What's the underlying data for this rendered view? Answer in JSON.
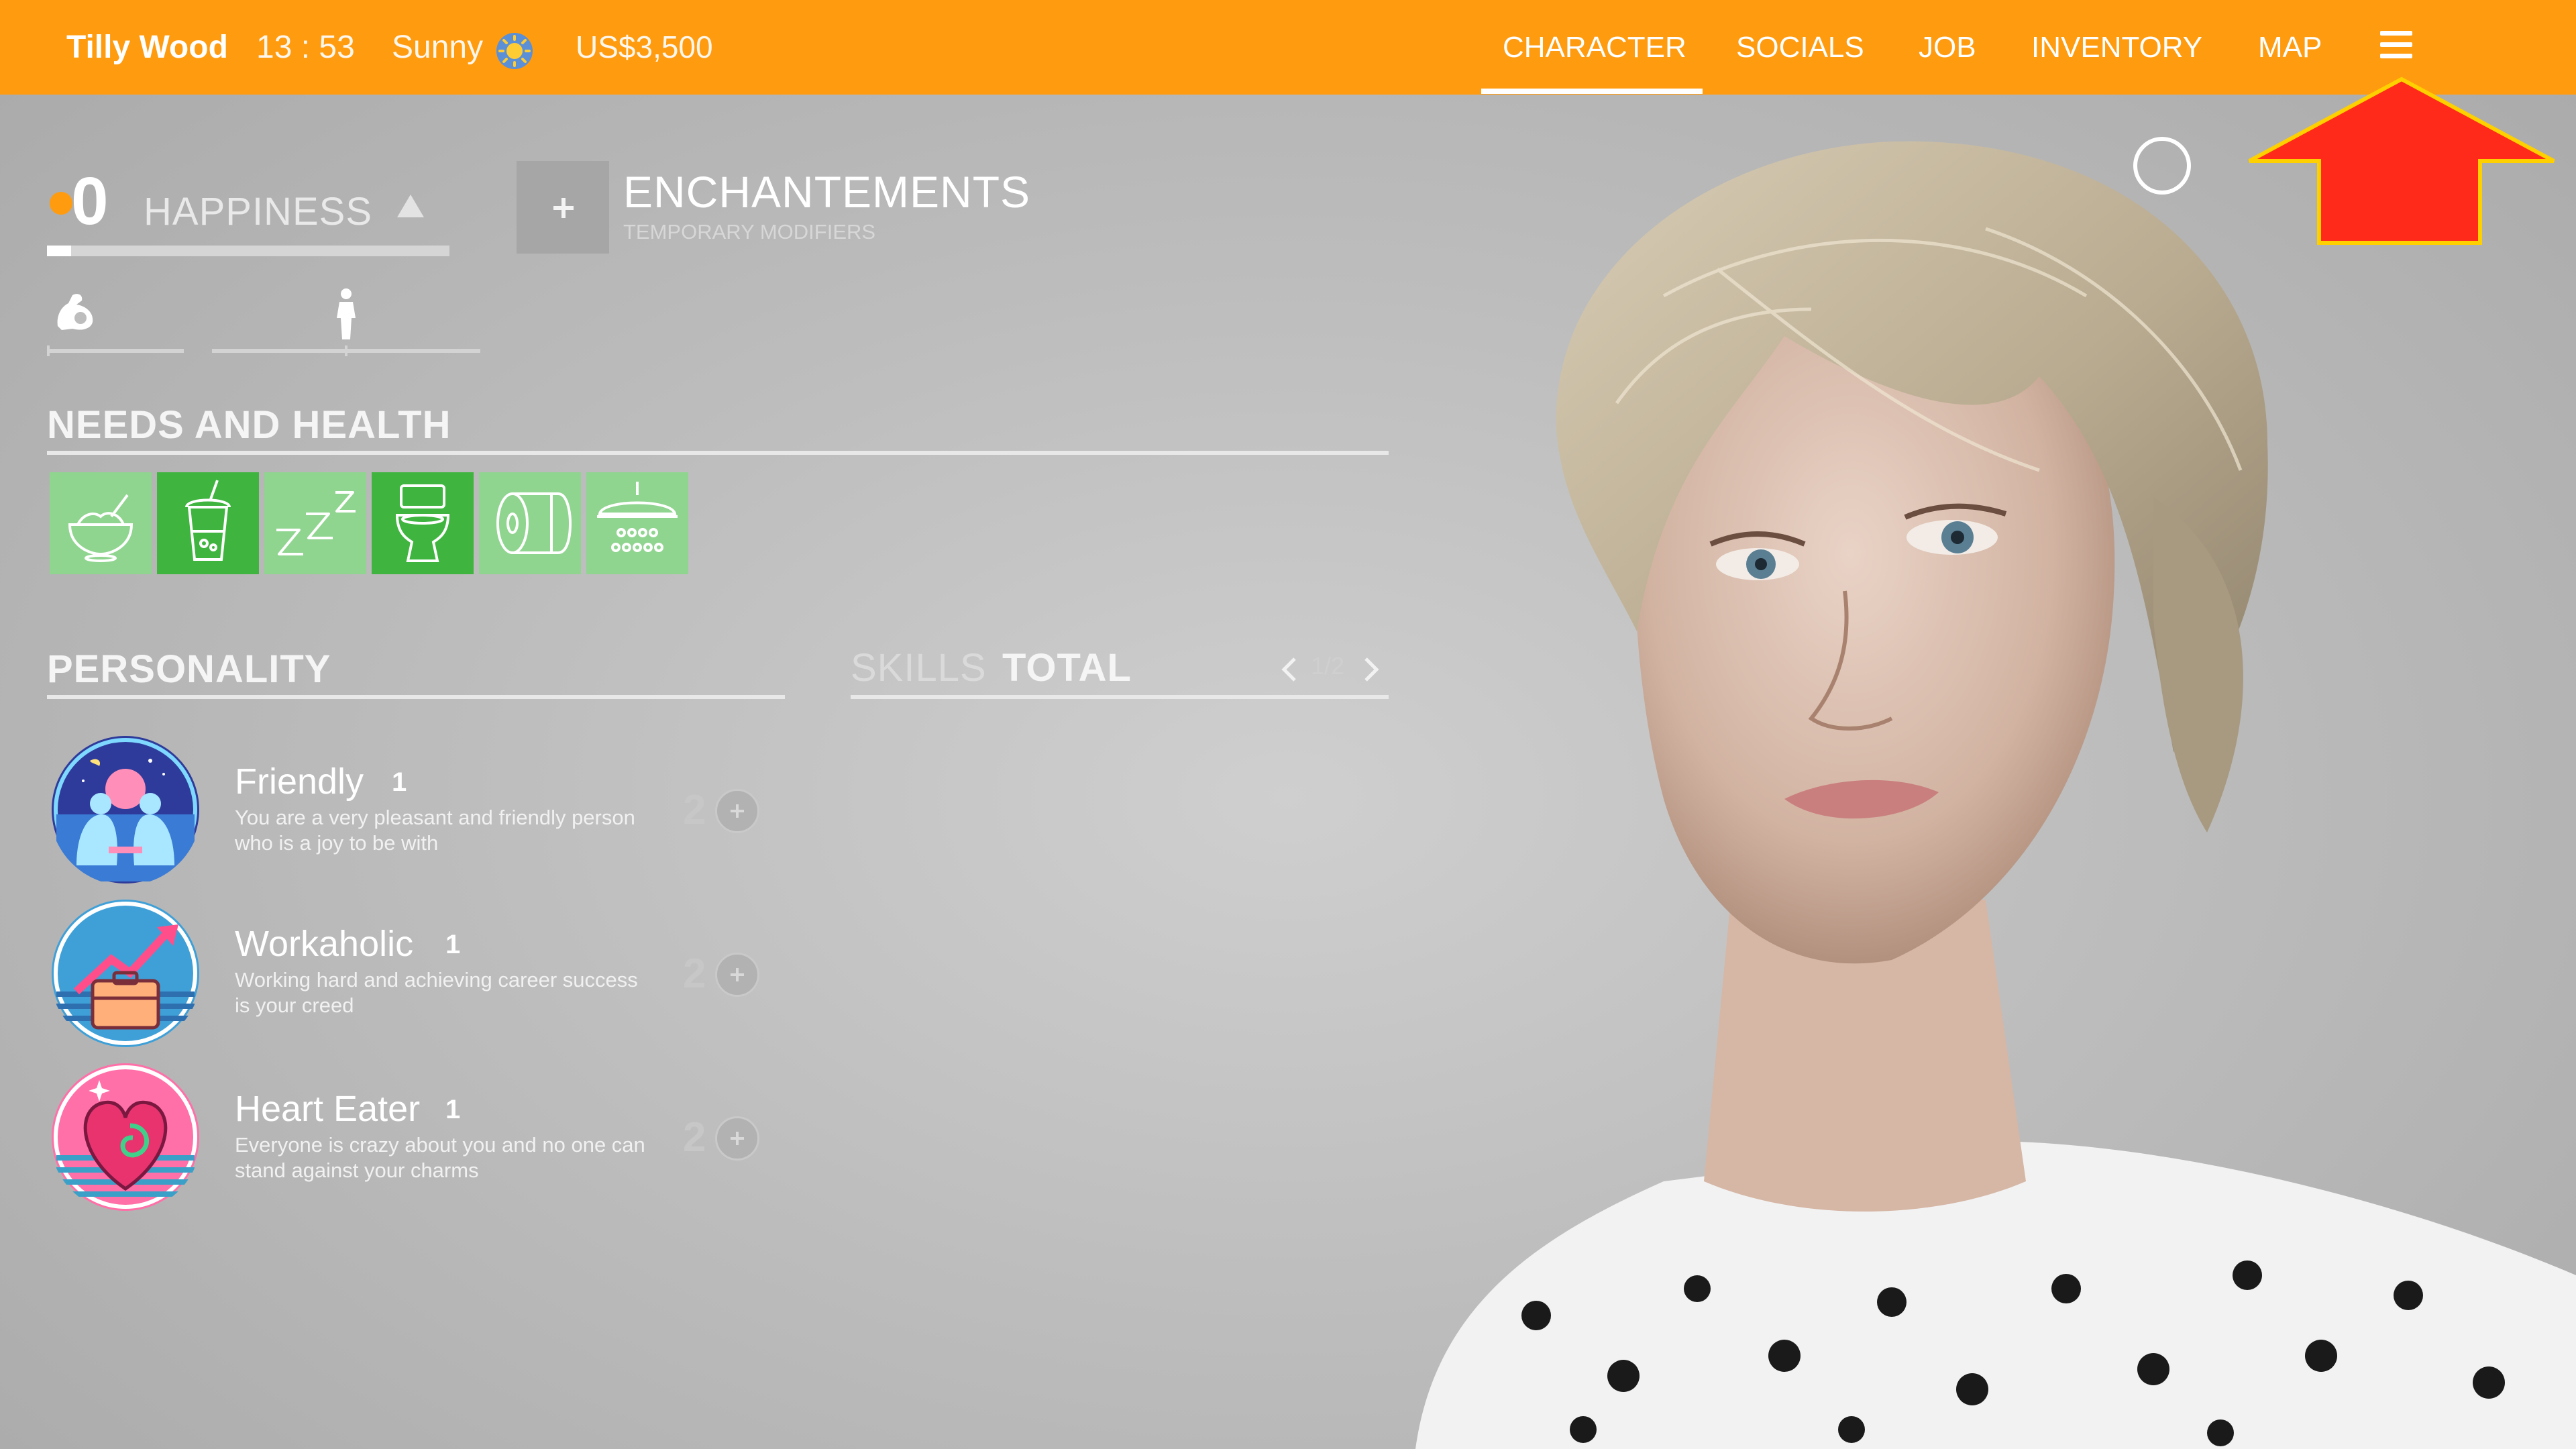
{
  "topbar": {
    "player_name": "Tilly Wood",
    "time": "13 : 53",
    "weather": "Sunny",
    "weather_icon": "sun-icon",
    "money": "US$3,500",
    "nav": [
      {
        "label": "CHARACTER",
        "active": true
      },
      {
        "label": "SOCIALS",
        "active": false
      },
      {
        "label": "JOB",
        "active": false
      },
      {
        "label": "INVENTORY",
        "active": false
      },
      {
        "label": "MAP",
        "active": false
      }
    ],
    "menu_icon": "hamburger-menu-icon"
  },
  "happiness": {
    "value": "0",
    "label": "HAPPINESS",
    "level_fraction": 0.06,
    "stats": [
      {
        "icon": "strength-arm-icon"
      },
      {
        "icon": "body-figure-icon"
      }
    ]
  },
  "enchantements": {
    "title": "ENCHANTEMENTS",
    "subtitle": "TEMPORARY MODIFIERS"
  },
  "needs": {
    "title": "NEEDS AND HEALTH",
    "items": [
      {
        "icon": "food-bowl-icon"
      },
      {
        "icon": "drink-cup-icon"
      },
      {
        "icon": "sleep-zzz-icon"
      },
      {
        "icon": "toilet-icon"
      },
      {
        "icon": "toilet-paper-icon"
      },
      {
        "icon": "shower-icon"
      }
    ]
  },
  "personality": {
    "title": "PERSONALITY",
    "traits": [
      {
        "name": "Friendly",
        "level": "1",
        "description": "You are a very pleasant and friendly person who is a joy to be with",
        "points": "2"
      },
      {
        "name": "Workaholic",
        "level": "1",
        "description": "Working hard and achieving career success is your creed",
        "points": "2"
      },
      {
        "name": "Heart Eater",
        "level": "1",
        "description": "Everyone is crazy about you and no one can stand against your charms",
        "points": "2"
      }
    ]
  },
  "skills": {
    "label": "SKILLS",
    "total_label": "TOTAL",
    "page": "1/2"
  },
  "colors": {
    "topbar": "#ff9b0f",
    "need_active": "#3fb43f",
    "need_inactive": "#8fd48f",
    "arrow": "#ff2a1a",
    "arrow_border": "#ffd000"
  }
}
